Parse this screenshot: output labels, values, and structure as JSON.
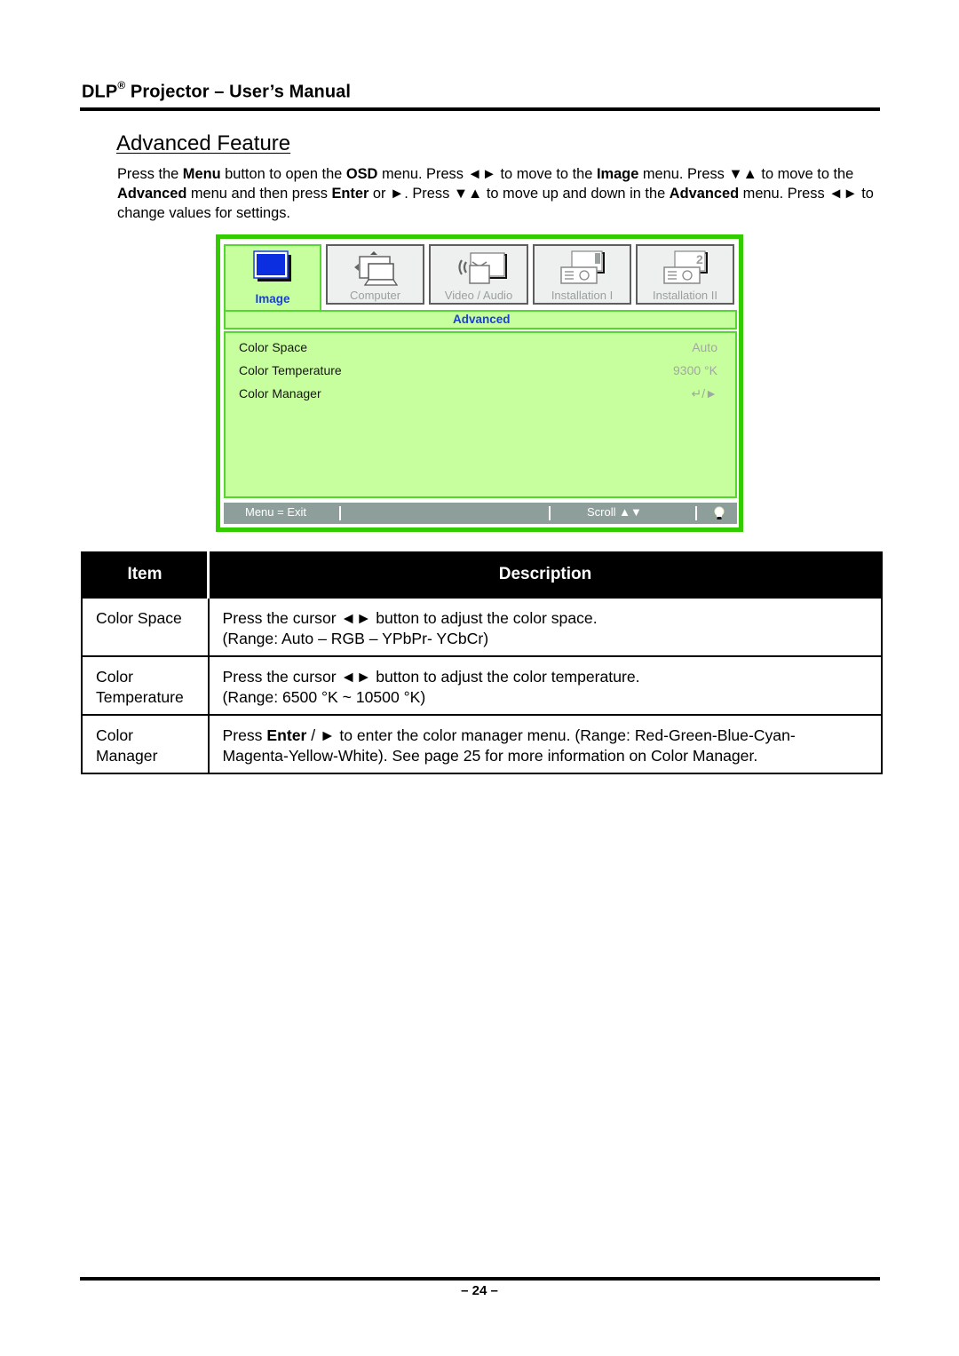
{
  "header": {
    "brand": "DLP",
    "registered_mark": "®",
    "title_rest": " Projector – User’s Manual"
  },
  "section": {
    "title": "Advanced Feature"
  },
  "intro": {
    "segments": [
      {
        "t": "Press the ",
        "b": false
      },
      {
        "t": "Menu",
        "b": true
      },
      {
        "t": " button to open the ",
        "b": false
      },
      {
        "t": "OSD",
        "b": true
      },
      {
        "t": " menu. Press ◄► to move to the ",
        "b": false
      },
      {
        "t": "Image",
        "b": true
      },
      {
        "t": " menu. Press ▼▲ to move to the ",
        "b": false
      },
      {
        "t": "Advanced",
        "b": true
      },
      {
        "t": " menu and then press ",
        "b": false
      },
      {
        "t": "Enter",
        "b": true
      },
      {
        "t": " or ►. Press ▼▲ to move up and down in the ",
        "b": false
      },
      {
        "t": "Advanced",
        "b": true
      },
      {
        "t": " menu. Press ◄► to change values for settings.",
        "b": false
      }
    ]
  },
  "osd": {
    "colors": {
      "frame": "#33cc00",
      "panel": "#c8ff9e",
      "active_text": "#1a3fd6",
      "inactive_text": "#9aa09e",
      "footer": "#8e9f9b"
    },
    "tabs": [
      {
        "label": "Image",
        "icon": "monitor-icon",
        "active": true
      },
      {
        "label": "Computer",
        "icon": "computer-icon",
        "active": false
      },
      {
        "label": "Video / Audio",
        "icon": "video-audio-icon",
        "active": false
      },
      {
        "label": "Installation I",
        "icon": "installation-1-icon",
        "active": false
      },
      {
        "label": "Installation II",
        "icon": "installation-2-icon",
        "active": false
      }
    ],
    "submenu_title": "Advanced",
    "items": [
      {
        "name": "Color Space",
        "value": "Auto"
      },
      {
        "name": "Color Temperature",
        "value": "9300 °K"
      },
      {
        "name": "Color Manager",
        "value": "↵/►",
        "value_icon": "enter-arrow-icon"
      }
    ],
    "footer": {
      "exit": "Menu = Exit",
      "scroll": "Scroll ▲▼",
      "lamp_icon": "lamp-icon"
    }
  },
  "table": {
    "headers": {
      "item": "Item",
      "description": "Description"
    },
    "rows": [
      {
        "item": "Color Space",
        "description_lines": [
          [
            {
              "t": "Press the cursor ◄► button to adjust the color space.",
              "b": false
            }
          ],
          [
            {
              "t": "(Range: Auto – RGB – YPbPr- YCbCr)",
              "b": false
            }
          ]
        ]
      },
      {
        "item": "Color Temperature",
        "description_lines": [
          [
            {
              "t": "Press the cursor ◄► button to adjust the color temperature.",
              "b": false
            }
          ],
          [
            {
              "t": "(Range: 6500 °K ~ 10500 °K)",
              "b": false
            }
          ]
        ]
      },
      {
        "item": "Color Manager",
        "description_lines": [
          [
            {
              "t": "Press ",
              "b": false
            },
            {
              "t": "Enter",
              "b": true
            },
            {
              "t": " / ► to enter the color manager menu. (Range: Red-Green-Blue-Cyan-",
              "b": false
            }
          ],
          [
            {
              "t": "Magenta-Yellow-White). See page 25 for more information on Color Manager.",
              "b": false
            }
          ]
        ]
      }
    ]
  },
  "footer": {
    "page_number": "– 24 –"
  }
}
